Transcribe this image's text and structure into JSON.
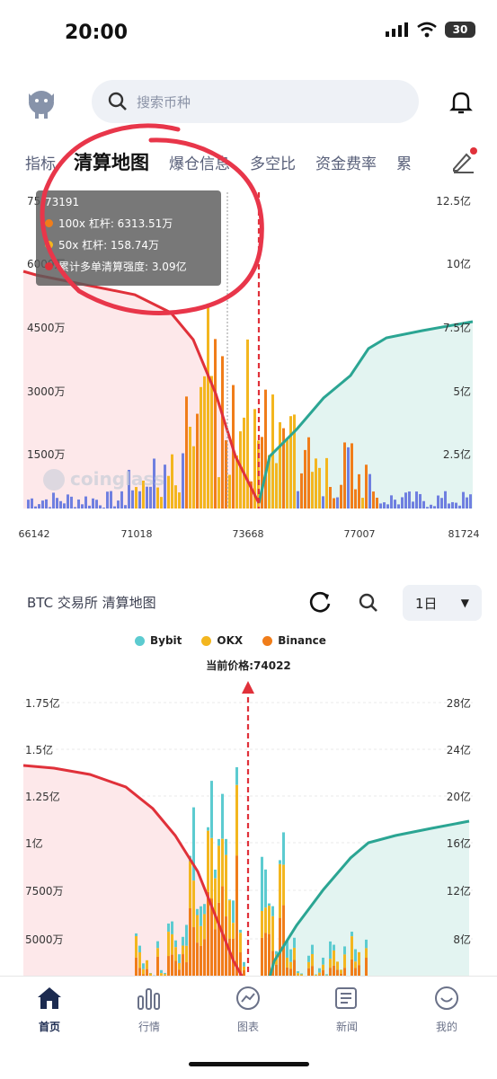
{
  "status": {
    "time": "20:00",
    "battery": "30"
  },
  "search": {
    "placeholder": "搜索币种"
  },
  "tabs": [
    {
      "label": "指标"
    },
    {
      "label": "清算地图"
    },
    {
      "label": "爆仓信息"
    },
    {
      "label": "多空比"
    },
    {
      "label": "资金费率"
    },
    {
      "label": "累"
    }
  ],
  "chart1": {
    "watermark": "coinglass",
    "left_ticks": [
      "75",
      "6000万",
      "4500万",
      "3000万",
      "1500万"
    ],
    "right_ticks": [
      "12.5亿",
      "10亿",
      "7.5亿",
      "5亿",
      "2.5亿"
    ],
    "x_ticks": [
      "66142",
      "71018",
      "73668",
      "77007",
      "81724"
    ],
    "tooltip": {
      "price": "73191",
      "line1": "100x 杠杆: 6313.51万",
      "line2": "50x 杠杆: 158.74万",
      "line3": "累计多单清算强度: 3.09亿"
    }
  },
  "chart_data": [
    {
      "type": "bar",
      "xlim": [
        66142,
        81724
      ],
      "current_price_marker": 73668,
      "series": [
        {
          "name": "100x 杠杆"
        },
        {
          "name": "50x 杠杆"
        },
        {
          "name": "累计多单清算强度"
        }
      ]
    },
    {
      "type": "bar",
      "current_price_marker": 74022,
      "series": [
        {
          "name": "Bybit"
        },
        {
          "name": "OKX"
        },
        {
          "name": "Binance"
        }
      ]
    }
  ],
  "section2": {
    "title": "BTC 交易所  清算地图",
    "day": "1日",
    "legend": [
      {
        "name": "Bybit",
        "color": "#5ccbd0"
      },
      {
        "name": "OKX",
        "color": "#f3b61f"
      },
      {
        "name": "Binance",
        "color": "#f07d1a"
      }
    ],
    "current_price": "当前价格:74022",
    "left_ticks": [
      "1.75亿",
      "1.5亿",
      "1.25亿",
      "1亿",
      "7500万",
      "5000万"
    ],
    "right_ticks": [
      "28亿",
      "24亿",
      "20亿",
      "16亿",
      "12亿",
      "8亿"
    ]
  },
  "nav": [
    {
      "label": "首页"
    },
    {
      "label": "行情"
    },
    {
      "label": "图表"
    },
    {
      "label": "新闻"
    },
    {
      "label": "我的"
    }
  ],
  "colors": {
    "accent": "#e0313a",
    "long_area": "#fde8ea",
    "short_area": "#e3f4f1",
    "long_line": "#e0313a",
    "short_line": "#2ba593",
    "bar_blue": "#6f7fe0",
    "bar_orange": "#f07d1a",
    "bar_yellow": "#f3b61f",
    "bar_teal": "#5ccbd0"
  }
}
